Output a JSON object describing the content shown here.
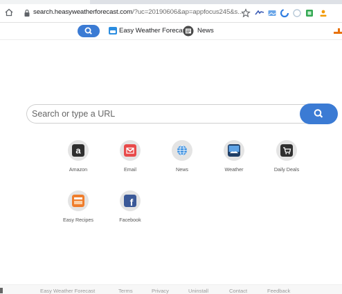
{
  "browser": {
    "url_host": "search.heasyweatherforecast.com",
    "url_rest": "/?uc=20190606&ap=appfocus245&s..."
  },
  "extension_bar": {
    "title": "Easy Weather Forecast",
    "news_label": "News"
  },
  "search": {
    "placeholder": "Search or type a URL"
  },
  "tiles": [
    {
      "label": "Amazon"
    },
    {
      "label": "Email"
    },
    {
      "label": "News"
    },
    {
      "label": "Weather"
    },
    {
      "label": "Daily Deals"
    },
    {
      "label": "Easy Recipes"
    },
    {
      "label": "Facebook"
    }
  ],
  "footer": {
    "links": [
      "Easy Weather Forecast",
      "Terms",
      "Privacy",
      "Uninstall",
      "Contact",
      "Feedback"
    ]
  },
  "colors": {
    "accent_blue": "#3b7bd4",
    "tile_bg": "#e4e4e4"
  }
}
